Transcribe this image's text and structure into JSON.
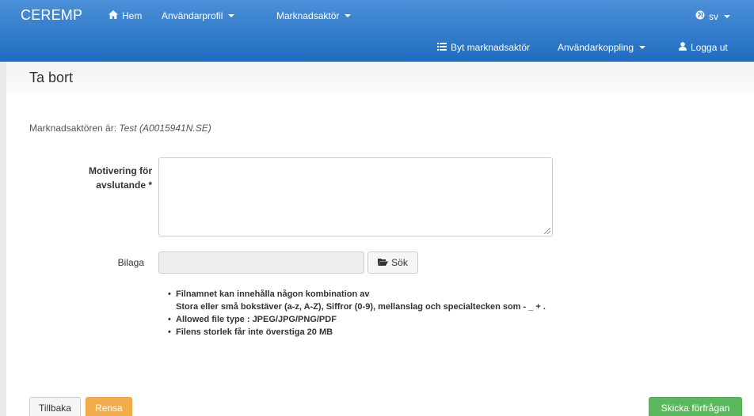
{
  "navbar": {
    "brand": "CEREMP",
    "home": "Hem",
    "user_profile": "Användarprofil",
    "market_actor": "Marknadsaktör",
    "language": "sv",
    "switch_actor": "Byt marknadsaktör",
    "user_link": "Användarkoppling",
    "logout": "Logga ut"
  },
  "page": {
    "title": "Ta bort",
    "actor_prefix": "Marknadsaktören är:",
    "actor_value": "Test (A0015941N.SE)"
  },
  "form": {
    "motivation_label_line1": "Motivering för",
    "motivation_label_line2": "avslutande *",
    "motivation_value": "",
    "attachment_label": "Bilaga",
    "attachment_value": "",
    "search_button": "Sök"
  },
  "rules": [
    "Filnamnet kan innehålla någon kombination av",
    "Stora eller små bokstäver (a-z, A-Z), Siffror (0-9), mellanslag och specialtecken som - _ + .",
    "Allowed file type : JPEG/JPG/PNG/PDF",
    "Filens storlek får inte överstiga 20 MB"
  ],
  "footer": {
    "back": "Tillbaka",
    "reset": "Rensa",
    "send": "Skicka förfrågan"
  },
  "colors": {
    "navbar_top": "#4b90d8",
    "navbar_bottom": "#1f6cc0",
    "reset_button": "#f0ad4e",
    "send_button": "#5cb85c"
  },
  "icons": {
    "home": "home-icon",
    "globe": "globe-icon",
    "list": "list-icon",
    "user": "user-icon",
    "folder": "folder-open-icon"
  }
}
